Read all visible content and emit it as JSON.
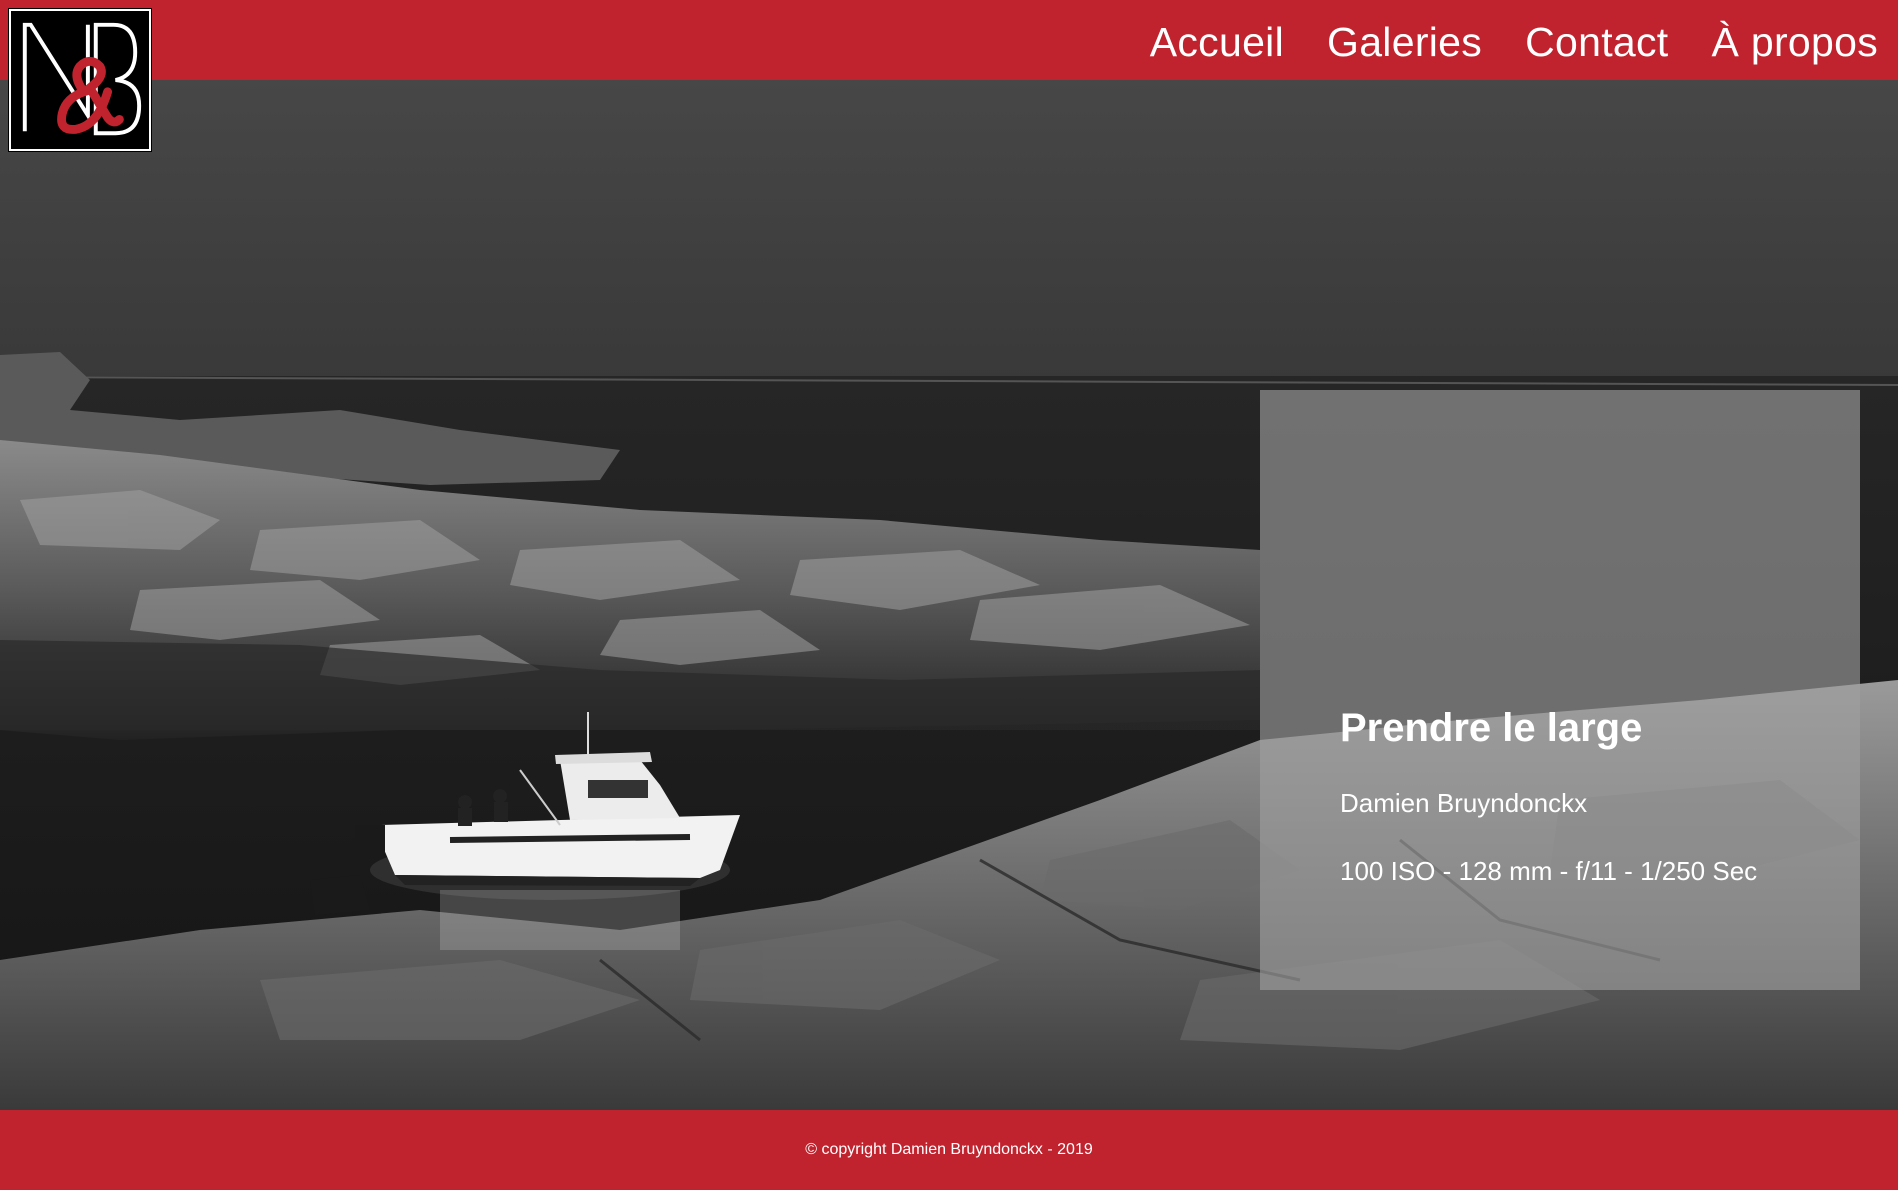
{
  "site": {
    "logo_alt": "N&B",
    "brand_color": "#c1232e"
  },
  "nav": {
    "items": [
      {
        "label": "Accueil"
      },
      {
        "label": "Galeries"
      },
      {
        "label": "Contact"
      },
      {
        "label": "À propos"
      }
    ]
  },
  "photo": {
    "title": "Prendre le large",
    "author": "Damien Bruyndonckx",
    "exif": "100 ISO - 128 mm - f/11 - 1/250 Sec"
  },
  "footer": {
    "copyright": "© copyright Damien Bruyndonckx - 2019"
  }
}
